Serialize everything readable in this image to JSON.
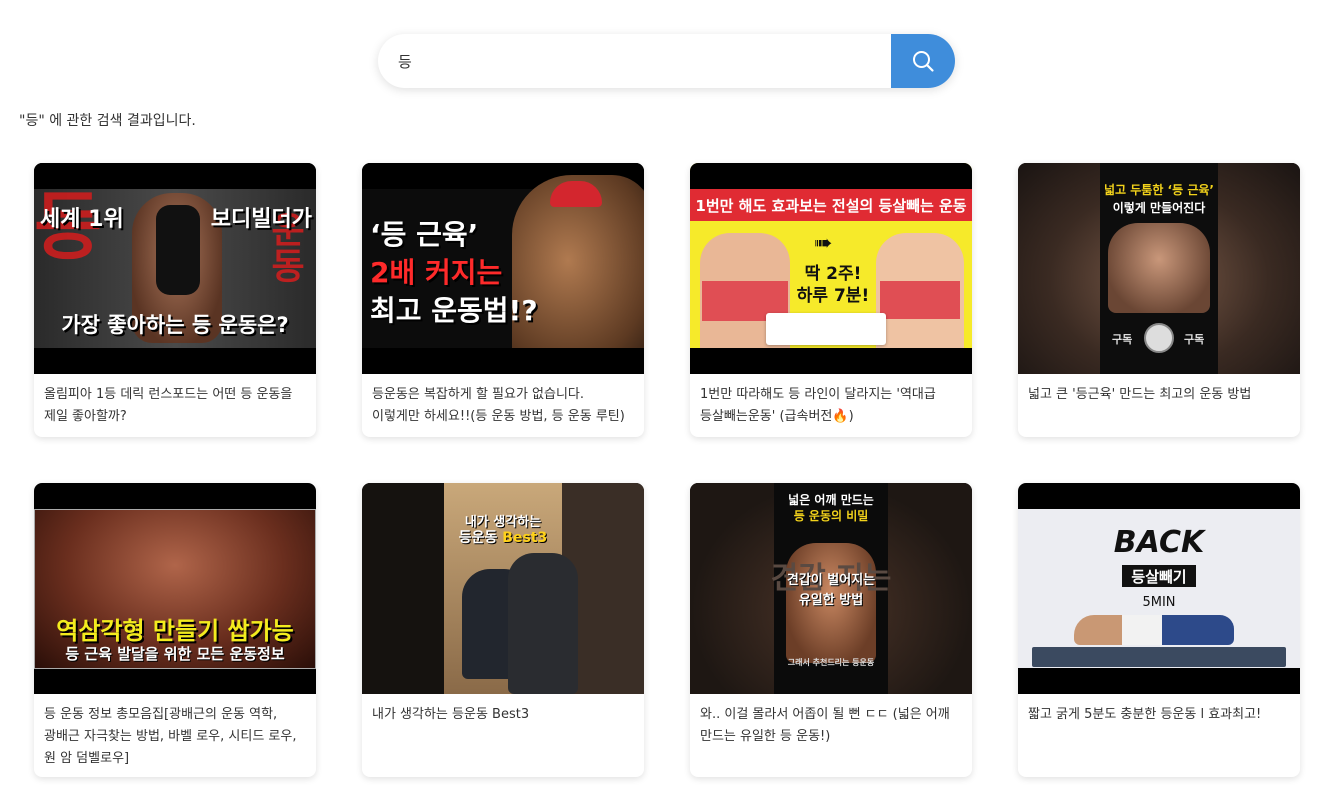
{
  "search": {
    "value": "등",
    "button_icon": "search-icon",
    "accent": "#3f8ddb"
  },
  "results_caption": "\"등\" 에 관한 검색 결과입니다.",
  "videos": [
    {
      "title": "올림피아 1등 데릭 런스포드는 어떤 등 운동을 제일 좋아할까?",
      "thumb": {
        "l1": "세계 1위",
        "l2": "보디빌더가",
        "l3": "가장 좋아하는 등 운동은?",
        "big_left": "등",
        "big_right": "운동"
      }
    },
    {
      "title": "등운동은 복잡하게 할 필요가 없습니다. 이렇게만 하세요!!(등 운동 방법, 등 운동 루틴)",
      "thumb": {
        "l1": "‘등 근육’",
        "l2": "2배 커지는",
        "l3": "최고 운동법!?"
      }
    },
    {
      "title": "1번만 따라해도 등 라인이 달라지는 '역대급 등살빼는운동' (급속버전🔥)",
      "thumb": {
        "banner": "1번만 해도 효과보는 전설의 등살빼는 운동",
        "l1": "딱 2주!",
        "l2": "하루 7분!"
      }
    },
    {
      "title": "넓고 큰 '등근육' 만드는 최고의 운동 방법",
      "thumb": {
        "l1": "넓고 두툼한 ‘등 근육’",
        "l2": "이렇게 만들어진다",
        "l3a": "구독",
        "l3b": "구독"
      }
    },
    {
      "title": "등 운동 정보 총모음집[광배근의 운동 역학, 광배근 자극찾는 방법, 바벨 로우, 시티드 로우, 원 암 덤벨로우]",
      "thumb": {
        "l1": "역삼각형 만들기 쌉가능",
        "l2": "등 근육 발달을 위한 모든 운동정보"
      }
    },
    {
      "title": "내가 생각하는 등운동 Best3",
      "thumb": {
        "l1": "내가 생각하는",
        "l2a": "등운동",
        "l2b": "Best3"
      }
    },
    {
      "title": "와.. 이걸 몰라서 어좁이 될 뻔 ㄷㄷ (넓은 어깨 만드는 유일한 등 운동!)",
      "thumb": {
        "l1": "넓은 어깨 만드는",
        "l2": "등 운동의 비밀",
        "l3": "견갑이 벌어지는",
        "l4": "유일한 방법",
        "l5": "그래서 추천드리는 등운동",
        "bg": "견갑 지는"
      }
    },
    {
      "title": "짧고 굵게 5분도 충분한 등운동 l 효과최고!",
      "thumb": {
        "l1": "BACK",
        "l2": "등살빼기",
        "l3": "5MIN"
      }
    }
  ]
}
